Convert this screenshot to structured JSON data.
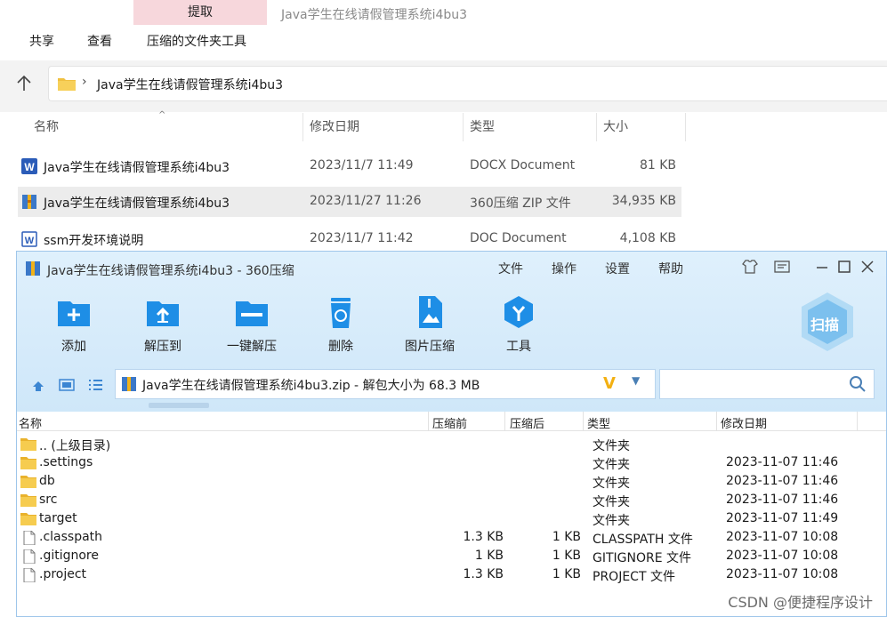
{
  "explorer": {
    "active_tab": "提取",
    "window_title": "Java学生在线请假管理系统i4bu3",
    "ribbon": [
      "共享",
      "查看",
      "压缩的文件夹工具"
    ],
    "address": "Java学生在线请假管理系统i4bu3",
    "columns": [
      "名称",
      "修改日期",
      "类型",
      "大小"
    ],
    "files": [
      {
        "name": "Java学生在线请假管理系统i4bu3",
        "date": "2023/11/7 11:49",
        "type": "DOCX Document",
        "size": "81 KB",
        "icon": "word-icon"
      },
      {
        "name": "Java学生在线请假管理系统i4bu3",
        "date": "2023/11/27 11:26",
        "type": "360压缩 ZIP 文件",
        "size": "34,935 KB",
        "icon": "zip-icon"
      },
      {
        "name": "ssm开发环境说明",
        "date": "2023/11/7 11:42",
        "type": "DOC Document",
        "size": "4,108 KB",
        "icon": "word-icon"
      }
    ]
  },
  "zip": {
    "title": "Java学生在线请假管理系统i4bu3 - 360压缩",
    "menu": [
      "文件",
      "操作",
      "设置",
      "帮助"
    ],
    "toolbar": [
      "添加",
      "解压到",
      "一键解压",
      "删除",
      "图片压缩",
      "工具"
    ],
    "scan_label": "扫描",
    "path": "Java学生在线请假管理系统i4bu3.zip - 解包大小为 68.3 MB",
    "columns": [
      "名称",
      "压缩前",
      "压缩后",
      "类型",
      "修改日期"
    ],
    "rows": [
      {
        "name": ".. (上级目录)",
        "size": "",
        "csize": "",
        "type": "文件夹",
        "date": "",
        "icon": "folder"
      },
      {
        "name": ".settings",
        "size": "",
        "csize": "",
        "type": "文件夹",
        "date": "2023-11-07 11:46",
        "icon": "folder"
      },
      {
        "name": "db",
        "size": "",
        "csize": "",
        "type": "文件夹",
        "date": "2023-11-07 11:46",
        "icon": "folder"
      },
      {
        "name": "src",
        "size": "",
        "csize": "",
        "type": "文件夹",
        "date": "2023-11-07 11:46",
        "icon": "folder"
      },
      {
        "name": "target",
        "size": "",
        "csize": "",
        "type": "文件夹",
        "date": "2023-11-07 11:49",
        "icon": "folder"
      },
      {
        "name": ".classpath",
        "size": "1.3 KB",
        "csize": "1 KB",
        "type": "CLASSPATH 文件",
        "date": "2023-11-07 10:08",
        "icon": "file"
      },
      {
        "name": ".gitignore",
        "size": "1 KB",
        "csize": "1 KB",
        "type": "GITIGNORE 文件",
        "date": "2023-11-07 10:08",
        "icon": "file"
      },
      {
        "name": ".project",
        "size": "1.3 KB",
        "csize": "1 KB",
        "type": "PROJECT 文件",
        "date": "2023-11-07 10:08",
        "icon": "file"
      }
    ]
  },
  "watermark": "CSDN @便捷程序设计"
}
